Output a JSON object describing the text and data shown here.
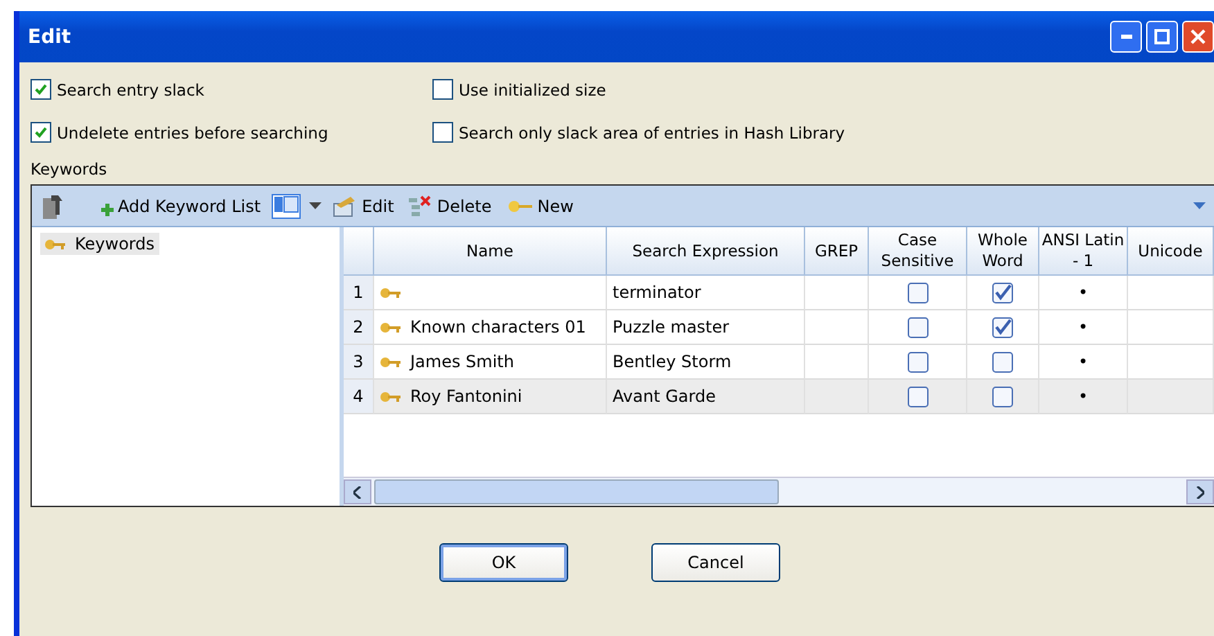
{
  "window": {
    "title": "Edit"
  },
  "options": [
    {
      "label": "Search entry slack",
      "checked": true
    },
    {
      "label": "Use initialized size",
      "checked": false
    },
    {
      "label": "Undelete entries before searching",
      "checked": true
    },
    {
      "label": "Search only slack area of entries in Hash Library",
      "checked": false
    }
  ],
  "keywords_label": "Keywords",
  "toolbar": [
    {
      "kind": "add",
      "label": "Add Keyword List"
    },
    {
      "kind": "layout"
    },
    {
      "kind": "edit",
      "label": "Edit"
    },
    {
      "kind": "delete",
      "label": "Delete"
    },
    {
      "kind": "new",
      "label": "New"
    }
  ],
  "tree": {
    "items": [
      {
        "label": "Keywords",
        "selected": true
      }
    ]
  },
  "table": {
    "columns": [
      "Name",
      "Search Expression",
      "GREP",
      "Case Sensitive",
      "Whole Word",
      "ANSI Latin - 1",
      "Unicode"
    ],
    "rows": [
      {
        "number": "1",
        "search_expression": "terminator",
        "case_sensitive": false,
        "whole_word": true,
        "ansi_latin_1": "•",
        "selected": false
      },
      {
        "number": "2",
        "name": "Known characters 01",
        "search_expression": "Puzzle master",
        "case_sensitive": false,
        "whole_word": true,
        "ansi_latin_1": "•",
        "selected": false
      },
      {
        "number": "3",
        "name": "James Smith",
        "search_expression": "Bentley Storm",
        "case_sensitive": false,
        "whole_word": false,
        "ansi_latin_1": "•",
        "selected": false
      },
      {
        "number": "4",
        "name": "Roy Fantonini",
        "search_expression": "Avant Garde",
        "case_sensitive": false,
        "whole_word": false,
        "ansi_latin_1": "•",
        "selected": true
      }
    ]
  },
  "buttons": [
    "OK",
    "Cancel"
  ]
}
